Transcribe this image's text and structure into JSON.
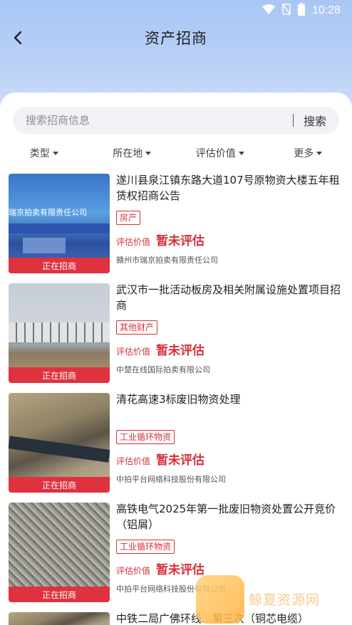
{
  "status": {
    "time": "10:28"
  },
  "nav": {
    "title": "资产招商"
  },
  "search": {
    "placeholder": "搜索招商信息",
    "button": "搜索"
  },
  "filters": [
    "类型",
    "所在地",
    "评估价值",
    "更多"
  ],
  "items": [
    {
      "title": "遂川县泉江镇东路大道107号原物资大楼五年租赁权招商公告",
      "tag": "房产",
      "value_label": "评估价值",
      "value": "暂未评估",
      "company": "赣州市瑞京拍卖有限责任公司",
      "status": "正在招商",
      "thumb_text": "瑞京拍卖有限责任公司"
    },
    {
      "title": "武汉市一批活动板房及相关附属设施处置项目招商",
      "tag": "其他财产",
      "value_label": "评估价值",
      "value": "暂未评估",
      "company": "中楚在线国际拍卖有限公司",
      "status": "正在招商"
    },
    {
      "title": "清花高速3标废旧物资处理",
      "tag": "工业循环物资",
      "value_label": "评估价值",
      "value": "暂未评估",
      "company": "中拍平台网络科技股份有限公司",
      "status": "正在招商"
    },
    {
      "title": "高铁电气2025年第一批废旧物资处置公开竞价（铝屑）",
      "tag": "工业循环物资",
      "value_label": "评估价值",
      "value": "暂未评估",
      "company": "中拍平台网络科技股份有限公司",
      "status": "正在招商"
    },
    {
      "title": "中铁二局广佛环线…第三次（铜芯电缆）"
    }
  ],
  "watermark": {
    "text": "鲸夏资源网"
  }
}
